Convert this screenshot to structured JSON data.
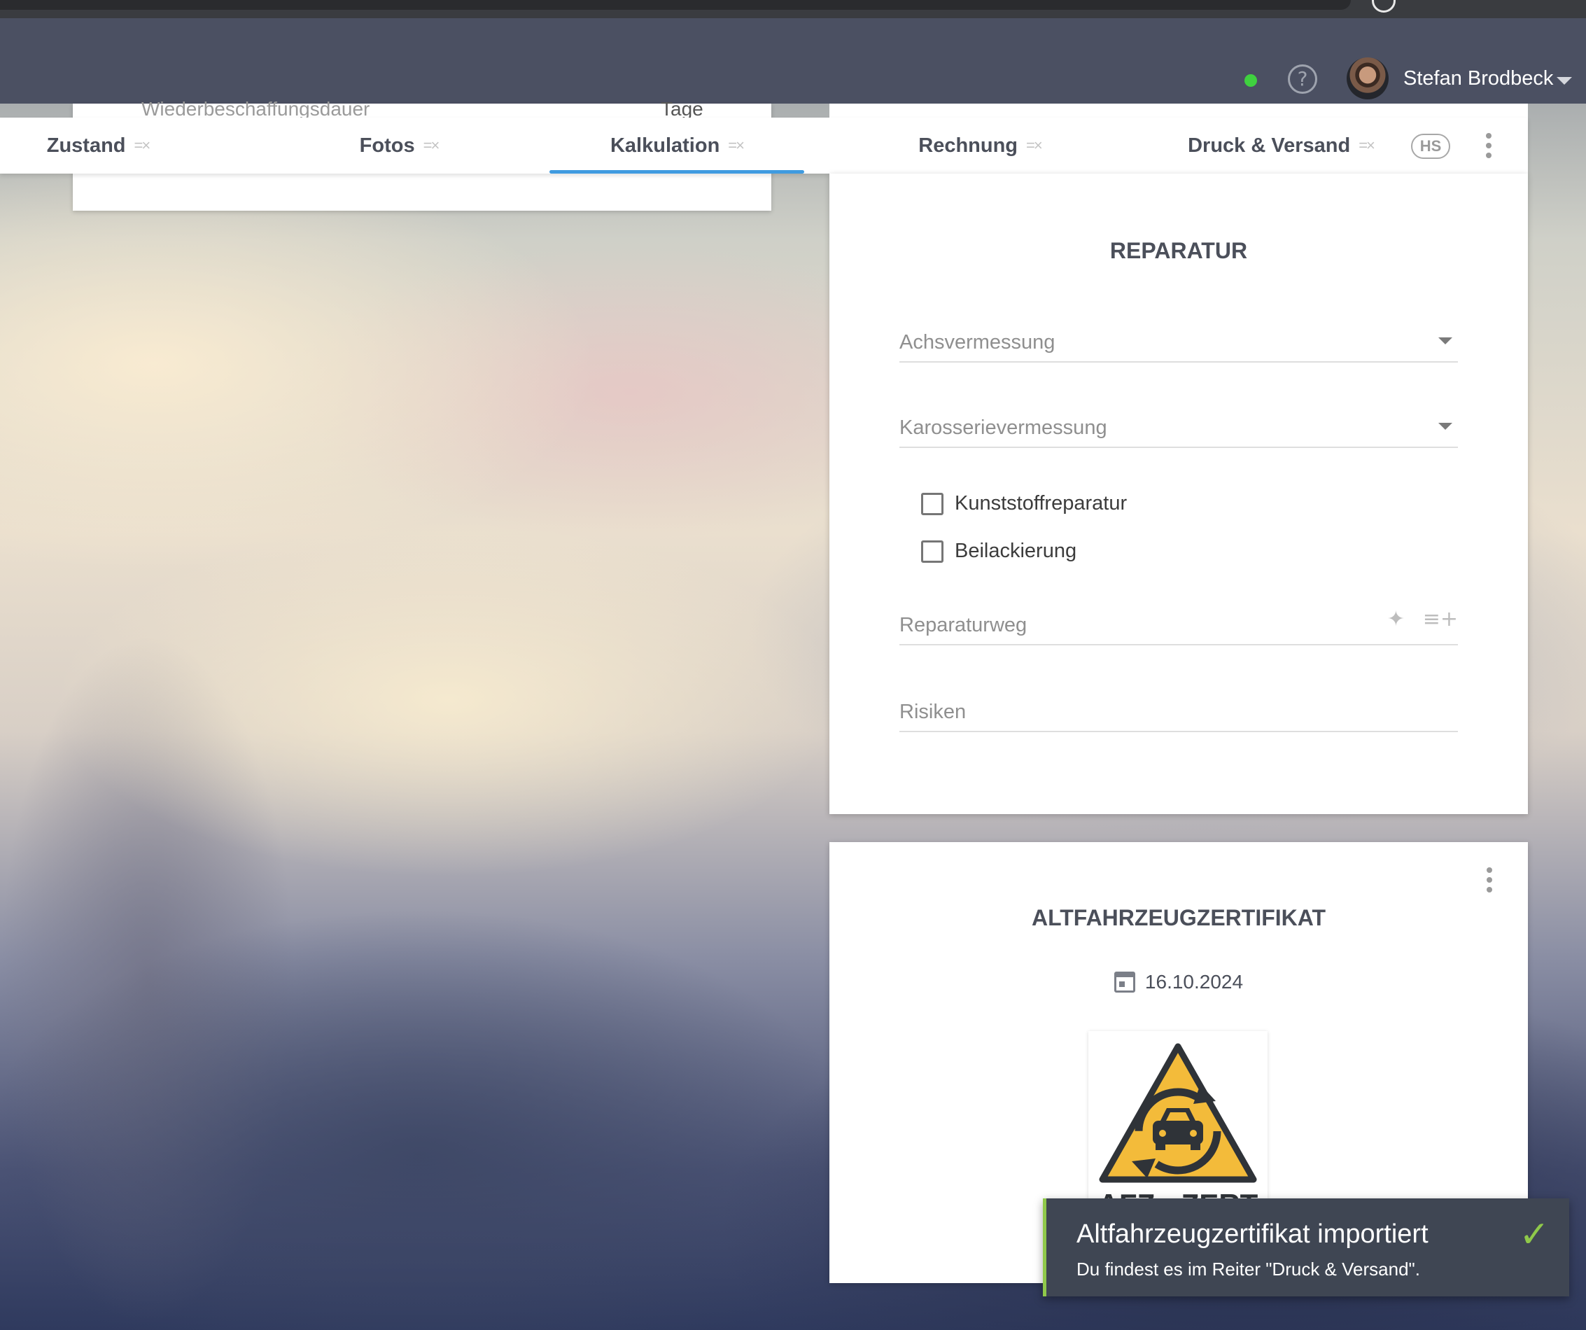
{
  "header": {
    "user_name": "Stefan Brodbeck",
    "status_color": "#3fd13f",
    "help_symbol": "?"
  },
  "left_card": {
    "row_label": "Wiederbeschaffungsdauer",
    "row_unit": "Tage"
  },
  "tabs": [
    {
      "label": "Zustand",
      "icon": "checklist-icon"
    },
    {
      "label": "Fotos",
      "icon": "checklist-icon"
    },
    {
      "label": "Kalkulation",
      "icon": "checklist-icon",
      "active": true
    },
    {
      "label": "Rechnung",
      "icon": "checklist-icon"
    },
    {
      "label": "Druck & Versand",
      "icon": "checklist-icon"
    }
  ],
  "tab_icon_glyph": "=×",
  "hs_badge": "HS",
  "reparatur": {
    "title": "REPARATUR",
    "achsvermessung": "Achsvermessung",
    "karosserievermessung": "Karosserievermessung",
    "checkbox_1": "Kunststoffreparatur",
    "checkbox_2": "Beilackierung",
    "reparaturweg": "Reparaturweg",
    "risiken": "Risiken"
  },
  "altfahrzeug": {
    "title": "ALTFAHRZEUGZERTIFIKAT",
    "date": "16.10.2024",
    "logo_text": "AFZ - ZERT"
  },
  "toast": {
    "title": "Altfahrzeugzertifikat importiert",
    "message": "Du findest es im Reiter \"Druck & Versand\".",
    "accent_color": "#8fc94a"
  },
  "accent_color": "#3f9be0"
}
